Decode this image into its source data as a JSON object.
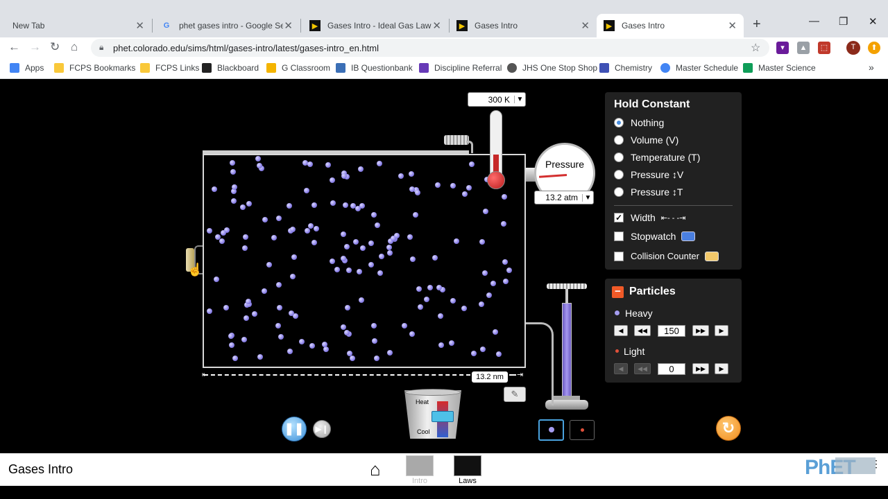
{
  "browser": {
    "tabs": [
      {
        "title": "New Tab",
        "active": false
      },
      {
        "title": "phet gases intro - Google Sear",
        "active": false
      },
      {
        "title": "Gases Intro - Ideal Gas Law | P",
        "active": false
      },
      {
        "title": "Gases Intro",
        "active": false
      },
      {
        "title": "Gases Intro",
        "active": true
      }
    ],
    "new_tab": "+",
    "url": "phet.colorado.edu/sims/html/gases-intro/latest/gases-intro_en.html",
    "profile_initial": "T",
    "bookmarks": [
      {
        "label": "Apps",
        "color": "#4285f4"
      },
      {
        "label": "FCPS Bookmarks",
        "color": "#f9c83a"
      },
      {
        "label": "FCPS Links",
        "color": "#f9c83a"
      },
      {
        "label": "Blackboard",
        "color": "#222222"
      },
      {
        "label": "G Classroom",
        "color": "#f4b400"
      },
      {
        "label": "IB Questionbank",
        "color": "#3b6fb6"
      },
      {
        "label": "Discipline Referral",
        "color": "#673ab7"
      },
      {
        "label": "JHS One Stop Shop",
        "color": "#555555"
      },
      {
        "label": "Chemistry",
        "color": "#3f51b5"
      },
      {
        "label": "Master Schedule",
        "color": "#4285f4"
      },
      {
        "label": "Master Science",
        "color": "#0f9d58"
      }
    ],
    "bookmarks_overflow": "»"
  },
  "sim": {
    "temperature": "300 K",
    "pressure_label": "Pressure",
    "pressure_value": "13.2 atm",
    "width_value": "13.2 nm",
    "heater_heat": "Heat",
    "heater_cool": "Cool",
    "heavy_particle_count_in_container": 150,
    "hold_constant": {
      "title": "Hold Constant",
      "options": [
        {
          "label": "Nothing",
          "selected": true
        },
        {
          "label": "Volume (V)",
          "selected": false
        },
        {
          "label": "Temperature (T)",
          "selected": false
        },
        {
          "label": "Pressure ↕V",
          "selected": false
        },
        {
          "label": "Pressure ↕T",
          "selected": false
        }
      ],
      "width_label": "Width",
      "width_checked": true,
      "stopwatch_label": "Stopwatch",
      "stopwatch_checked": false,
      "collision_label": "Collision Counter",
      "collision_checked": false
    },
    "particles": {
      "title": "Particles",
      "heavy_label": "Heavy",
      "heavy_value": "150",
      "light_label": "Light",
      "light_value": "0",
      "heavy_color": "#8a80e6",
      "light_color": "#e0503a"
    },
    "accent_orange": "#f08c1e"
  },
  "navbar": {
    "sim_title": "Gases Intro",
    "screens": [
      {
        "label": "Intro",
        "active": false
      },
      {
        "label": "Laws",
        "active": true
      }
    ]
  }
}
